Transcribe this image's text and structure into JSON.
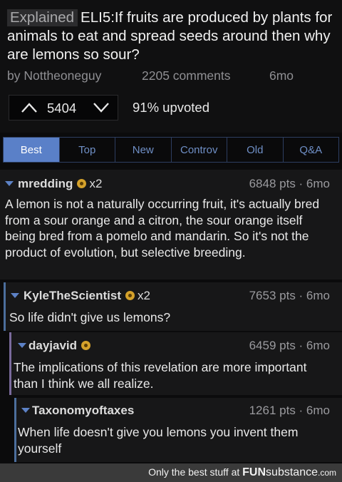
{
  "post": {
    "flair": "Explained",
    "title": "ELI5:If fruits are produced by plants for animals to eat and spread seeds around then why are lemons so sour?",
    "author": "by Nottheoneguy",
    "comments": "2205 comments",
    "age": "6mo",
    "score": "5404",
    "upvoted": "91% upvoted"
  },
  "sort_tabs": [
    {
      "label": "Best",
      "active": true
    },
    {
      "label": "Top"
    },
    {
      "label": "New"
    },
    {
      "label": "Controv"
    },
    {
      "label": "Old"
    },
    {
      "label": "Q&A"
    }
  ],
  "comments": [
    {
      "author": "mredding",
      "gilds": "x2",
      "points": "6848 pts · 6mo",
      "text": "A lemon is not a naturally occurring fruit, it's actually bred from a sour orange and a citron, the sour orange itself being bred from a pomelo and mandarin. So it's not the product of evolution, but selective breeding."
    },
    {
      "author": "KyleTheScientist",
      "gilds": "x2",
      "points": "7653 pts · 6mo",
      "text": "So life didn't give us lemons?"
    },
    {
      "author": "dayjavid",
      "points": "6459 pts · 6mo",
      "text": "The implications of this revelation are more important than I think we all realize."
    },
    {
      "author": "Taxonomyoftaxes",
      "points": "1261 pts · 6mo",
      "text": "When life doesn't give you lemons you invent them yourself"
    }
  ],
  "footer": {
    "tagline": "Only the best stuff at",
    "brand_a": "FUN",
    "brand_b": "substance",
    "brand_c": ".com"
  },
  "colors": {
    "accent": "#5a80c8",
    "gold_award": "#d4a12b",
    "thread_level1": "#4c6e9c",
    "thread_level2": "#7a6a9c",
    "thread_level3": "#4c6e9c"
  }
}
